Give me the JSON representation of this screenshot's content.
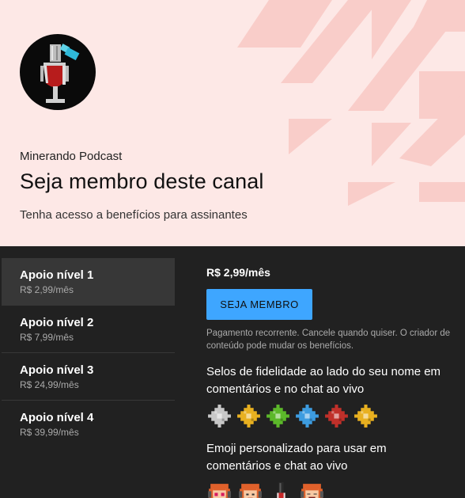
{
  "header": {
    "channel_name": "Minerando Podcast",
    "title": "Seja membro deste canal",
    "subtitle": "Tenha acesso a benefícios para assinantes",
    "background_color": "#fde8e6",
    "shape_color": "#f9c9c5"
  },
  "tiers": [
    {
      "name": "Apoio nível 1",
      "price": "R$ 2,99/mês",
      "selected": true
    },
    {
      "name": "Apoio nível 2",
      "price": "R$ 7,99/mês",
      "selected": false
    },
    {
      "name": "Apoio nível 3",
      "price": "R$ 24,99/mês",
      "selected": false
    },
    {
      "name": "Apoio nível 4",
      "price": "R$ 39,99/mês",
      "selected": false
    }
  ],
  "detail": {
    "price": "R$ 2,99/mês",
    "join_label": "SEJA MEMBRO",
    "note": "Pagamento recorrente. Cancele quando quiser. O criador de conteúdo pode mudar os benefícios.",
    "perk_badges_title": "Selos de fidelidade ao lado do seu nome em comentários e no chat ao vivo",
    "badge_colors": [
      "#c8c8c8",
      "#e8b020",
      "#5cb82a",
      "#3d9ce0",
      "#c0302a",
      "#e8b020"
    ],
    "perk_emoji_title": "Emoji personalizado para usar em comentários e chat ao vivo",
    "emoji_icons": [
      "girl-heart-eyes-emoji",
      "girl-smile-emoji",
      "microphone-emoji",
      "girl-laughing-emoji"
    ]
  },
  "colors": {
    "accent": "#3ea6ff",
    "panel": "#212121",
    "selected_tier": "#373737"
  }
}
